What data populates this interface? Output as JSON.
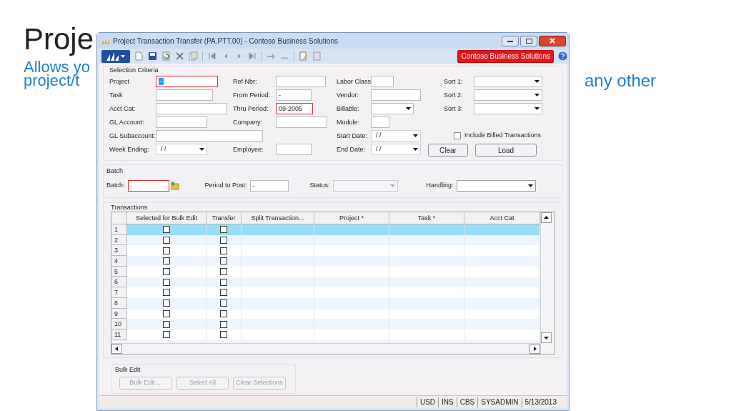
{
  "slide": {
    "title": "Proje",
    "subtitle_lines": [
      "Allows yo",
      "project/t"
    ],
    "subtitle_right": "any other"
  },
  "window": {
    "title": "Project Transaction Transfer (PA.PTT.00) - Contoso Business Solutions",
    "company_button": "Contoso Business Solutions"
  },
  "selection_criteria": {
    "title": "Selection Criteria",
    "rows": [
      [
        {
          "kind": "text",
          "label": "Project",
          "value": "-",
          "error": true,
          "focused": true
        },
        {
          "kind": "text",
          "label": "Ref Nbr:",
          "error": false
        },
        {
          "kind": "text",
          "label": "Labor Class:",
          "error": false
        },
        {
          "kind": "combo",
          "label": "Sort 1:"
        }
      ],
      [
        {
          "kind": "text",
          "label": "Task",
          "error": false
        },
        {
          "kind": "text",
          "label": "From Period:",
          "value": "-",
          "error": false
        },
        {
          "kind": "text",
          "label": "Vendor:",
          "error": false
        },
        {
          "kind": "combo",
          "label": "Sort 2:"
        }
      ],
      [
        {
          "kind": "text",
          "label": "Acct Cat:",
          "error": false
        },
        {
          "kind": "text",
          "label": "Thru Period:",
          "value": "09-2005",
          "error": true
        },
        {
          "kind": "combo",
          "label": "Billable:"
        },
        {
          "kind": "combo",
          "label": "Sort 3:"
        }
      ],
      [
        {
          "kind": "text",
          "label": "GL Account:",
          "error": false
        },
        {
          "kind": "text",
          "label": "Company:",
          "error": false
        },
        {
          "kind": "text",
          "label": "Module:",
          "error": false
        }
      ],
      [
        {
          "kind": "wide",
          "label": "GL Subaccount:",
          "error": false
        },
        "",
        {
          "kind": "date",
          "label": "Start Date:",
          "value": "/ /"
        },
        {
          "kind": "checkbox",
          "label": "Include Billed Transactions",
          "checked": false
        }
      ],
      [
        {
          "kind": "date",
          "label": "Week Ending:",
          "value": "/ /"
        },
        {
          "kind": "text",
          "label": "Employee:",
          "error": false
        },
        {
          "kind": "date",
          "label": "End Date:",
          "value": "/ /"
        },
        {
          "kind": "buttons",
          "labels": [
            "Clear",
            "Load"
          ]
        }
      ]
    ]
  },
  "batch": {
    "title": "Batch",
    "fields": [
      {
        "kind": "text",
        "label": "Batch:",
        "error": true
      },
      {
        "kind": "text",
        "label": "Period to Post:",
        "value": "-",
        "error": false
      },
      {
        "kind": "combo",
        "label": "Status:",
        "disabled": true
      },
      {
        "kind": "combo",
        "label": "Handling:",
        "disabled": false
      }
    ]
  },
  "transactions": {
    "title": "Transactions",
    "columns": [
      "Selected for Bulk Edit",
      "Transfer",
      "Split Transaction...",
      "Project *",
      "Task *",
      "Acct Cat"
    ],
    "rows": [
      {
        "number": "1",
        "selected": true,
        "bulk_edit": false,
        "transfer": false
      },
      {
        "number": "2",
        "selected": false,
        "bulk_edit": false,
        "transfer": false
      },
      {
        "number": "3",
        "selected": false,
        "bulk_edit": false,
        "transfer": false
      },
      {
        "number": "4",
        "selected": false,
        "bulk_edit": false,
        "transfer": false
      },
      {
        "number": "5",
        "selected": false,
        "bulk_edit": false,
        "transfer": false
      },
      {
        "number": "6",
        "selected": false,
        "bulk_edit": false,
        "transfer": false
      },
      {
        "number": "7",
        "selected": false,
        "bulk_edit": false,
        "transfer": false
      },
      {
        "number": "8",
        "selected": false,
        "bulk_edit": false,
        "transfer": false
      },
      {
        "number": "9",
        "selected": false,
        "bulk_edit": false,
        "transfer": false
      },
      {
        "number": "10",
        "selected": false,
        "bulk_edit": false,
        "transfer": false
      },
      {
        "number": "11",
        "selected": false,
        "bulk_edit": false,
        "transfer": false
      }
    ]
  },
  "bulk_edit": {
    "title": "Bulk Edit",
    "buttons": [
      {
        "label": "Bulk Edit ...",
        "disabled": true
      },
      {
        "label": "Select All",
        "disabled": true
      },
      {
        "label": "Clear Selections",
        "disabled": true
      }
    ]
  },
  "status_bar": [
    "USD",
    "INS",
    "CBS",
    "SYSADMIN",
    "5/13/2013"
  ]
}
